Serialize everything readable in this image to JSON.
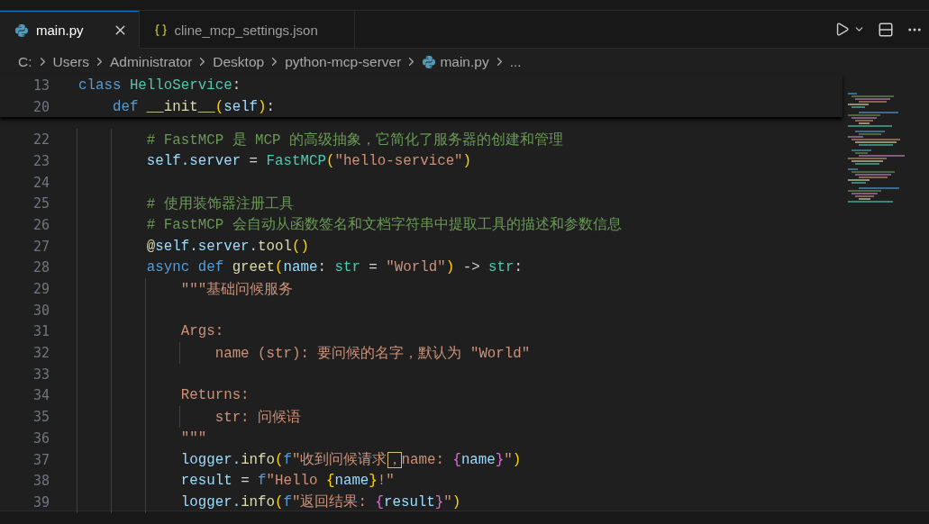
{
  "tabs": [
    {
      "label": "main.py",
      "kind": "python",
      "selected": true
    },
    {
      "label": "cline_mcp_settings.json",
      "kind": "json",
      "selected": false
    }
  ],
  "breadcrumb": [
    {
      "label": "C:",
      "kind": "folder"
    },
    {
      "label": "Users",
      "kind": "folder"
    },
    {
      "label": "Administrator",
      "kind": "folder"
    },
    {
      "label": "Desktop",
      "kind": "folder"
    },
    {
      "label": "python-mcp-server",
      "kind": "folder"
    },
    {
      "label": "main.py",
      "kind": "python"
    },
    {
      "label": "...",
      "kind": "more"
    }
  ],
  "sticky_lines": [
    {
      "number": "13",
      "tokens": [
        {
          "kind": "kw",
          "text": "class "
        },
        {
          "kind": "cls",
          "text": "HelloService"
        },
        {
          "kind": "punc",
          "text": ":"
        }
      ]
    },
    {
      "number": "20",
      "tokens": [
        {
          "kind": "kw",
          "text": "    def "
        },
        {
          "kind": "fn",
          "text": "__init__"
        },
        {
          "kind": "br1",
          "text": "("
        },
        {
          "kind": "var",
          "text": "self"
        },
        {
          "kind": "br1",
          "text": ")"
        },
        {
          "kind": "punc",
          "text": ":"
        }
      ]
    }
  ],
  "lines": [
    {
      "number": "22",
      "tokens": [
        {
          "kind": "cmt",
          "text": "        # FastMCP 是 MCP 的高级抽象，它简化了服务器的创建和管理"
        }
      ]
    },
    {
      "number": "23",
      "tokens": [
        {
          "kind": "var",
          "text": "        self.server "
        },
        {
          "kind": "punc",
          "text": "= "
        },
        {
          "kind": "cls",
          "text": "FastMCP"
        },
        {
          "kind": "br1",
          "text": "("
        },
        {
          "kind": "str",
          "text": "\"hello-service\""
        },
        {
          "kind": "br1",
          "text": ")"
        }
      ]
    },
    {
      "number": "24"
    },
    {
      "number": "25",
      "tokens": [
        {
          "kind": "cmt",
          "text": "        # 使用装饰器注册工具"
        }
      ]
    },
    {
      "number": "26",
      "tokens": [
        {
          "kind": "cmt",
          "text": "        # FastMCP 会自动从函数签名和文档字符串中提取工具的描述和参数信息"
        }
      ]
    },
    {
      "number": "27",
      "tokens": [
        {
          "kind": "fn",
          "text": "        @"
        },
        {
          "kind": "var",
          "text": "self.server."
        },
        {
          "kind": "fn",
          "text": "tool"
        },
        {
          "kind": "br1",
          "text": "()"
        }
      ]
    },
    {
      "number": "28",
      "tokens": [
        {
          "kind": "kw",
          "text": "        async def "
        },
        {
          "kind": "fn",
          "text": "greet"
        },
        {
          "kind": "br1",
          "text": "("
        },
        {
          "kind": "var",
          "text": "name"
        },
        {
          "kind": "punc",
          "text": ": "
        },
        {
          "kind": "cls",
          "text": "str"
        },
        {
          "kind": "punc",
          "text": " = "
        },
        {
          "kind": "str",
          "text": "\"World\""
        },
        {
          "kind": "br1",
          "text": ")"
        },
        {
          "kind": "punc",
          "text": " -> "
        },
        {
          "kind": "cls",
          "text": "str"
        },
        {
          "kind": "punc",
          "text": ":"
        }
      ]
    },
    {
      "number": "29",
      "tokens": [
        {
          "kind": "str",
          "text": "            \"\"\"基础问候服务"
        }
      ]
    },
    {
      "number": "30"
    },
    {
      "number": "31",
      "tokens": [
        {
          "kind": "str",
          "text": "            Args:"
        }
      ]
    },
    {
      "number": "32",
      "tokens": [
        {
          "kind": "str",
          "text": "                name (str): 要问候的名字，默认为 \"World\""
        }
      ]
    },
    {
      "number": "33"
    },
    {
      "number": "34",
      "tokens": [
        {
          "kind": "str",
          "text": "            Returns:"
        }
      ]
    },
    {
      "number": "35",
      "tokens": [
        {
          "kind": "str",
          "text": "                str: 问候语"
        }
      ]
    },
    {
      "number": "36",
      "tokens": [
        {
          "kind": "str",
          "text": "            \"\"\""
        }
      ]
    },
    {
      "number": "37",
      "tokens": [
        {
          "kind": "var",
          "text": "            logger."
        },
        {
          "kind": "fn",
          "text": "info"
        },
        {
          "kind": "br1",
          "text": "("
        },
        {
          "kind": "kw",
          "text": "f"
        },
        {
          "kind": "str",
          "text": "\"收到问候请求"
        },
        {
          "kind": "boxed",
          "text": "，"
        },
        {
          "kind": "str",
          "text": "name: "
        },
        {
          "kind": "br2",
          "text": "{"
        },
        {
          "kind": "var",
          "text": "name"
        },
        {
          "kind": "br2",
          "text": "}"
        },
        {
          "kind": "str",
          "text": "\""
        },
        {
          "kind": "br1",
          "text": ")"
        }
      ]
    },
    {
      "number": "38",
      "tokens": [
        {
          "kind": "var",
          "text": "            result "
        },
        {
          "kind": "punc",
          "text": "= "
        },
        {
          "kind": "kw",
          "text": "f"
        },
        {
          "kind": "str",
          "text": "\"Hello "
        },
        {
          "kind": "br1",
          "text": "{"
        },
        {
          "kind": "var",
          "text": "name"
        },
        {
          "kind": "br1",
          "text": "}"
        },
        {
          "kind": "str",
          "text": "!\""
        }
      ]
    },
    {
      "number": "39",
      "tokens": [
        {
          "kind": "var",
          "text": "            logger."
        },
        {
          "kind": "fn",
          "text": "info"
        },
        {
          "kind": "br1",
          "text": "("
        },
        {
          "kind": "kw",
          "text": "f"
        },
        {
          "kind": "str",
          "text": "\"返回结果: "
        },
        {
          "kind": "br2",
          "text": "{"
        },
        {
          "kind": "var",
          "text": "result"
        },
        {
          "kind": "br2",
          "text": "}"
        },
        {
          "kind": "str",
          "text": "\""
        },
        {
          "kind": "br1",
          "text": ")"
        }
      ]
    }
  ]
}
